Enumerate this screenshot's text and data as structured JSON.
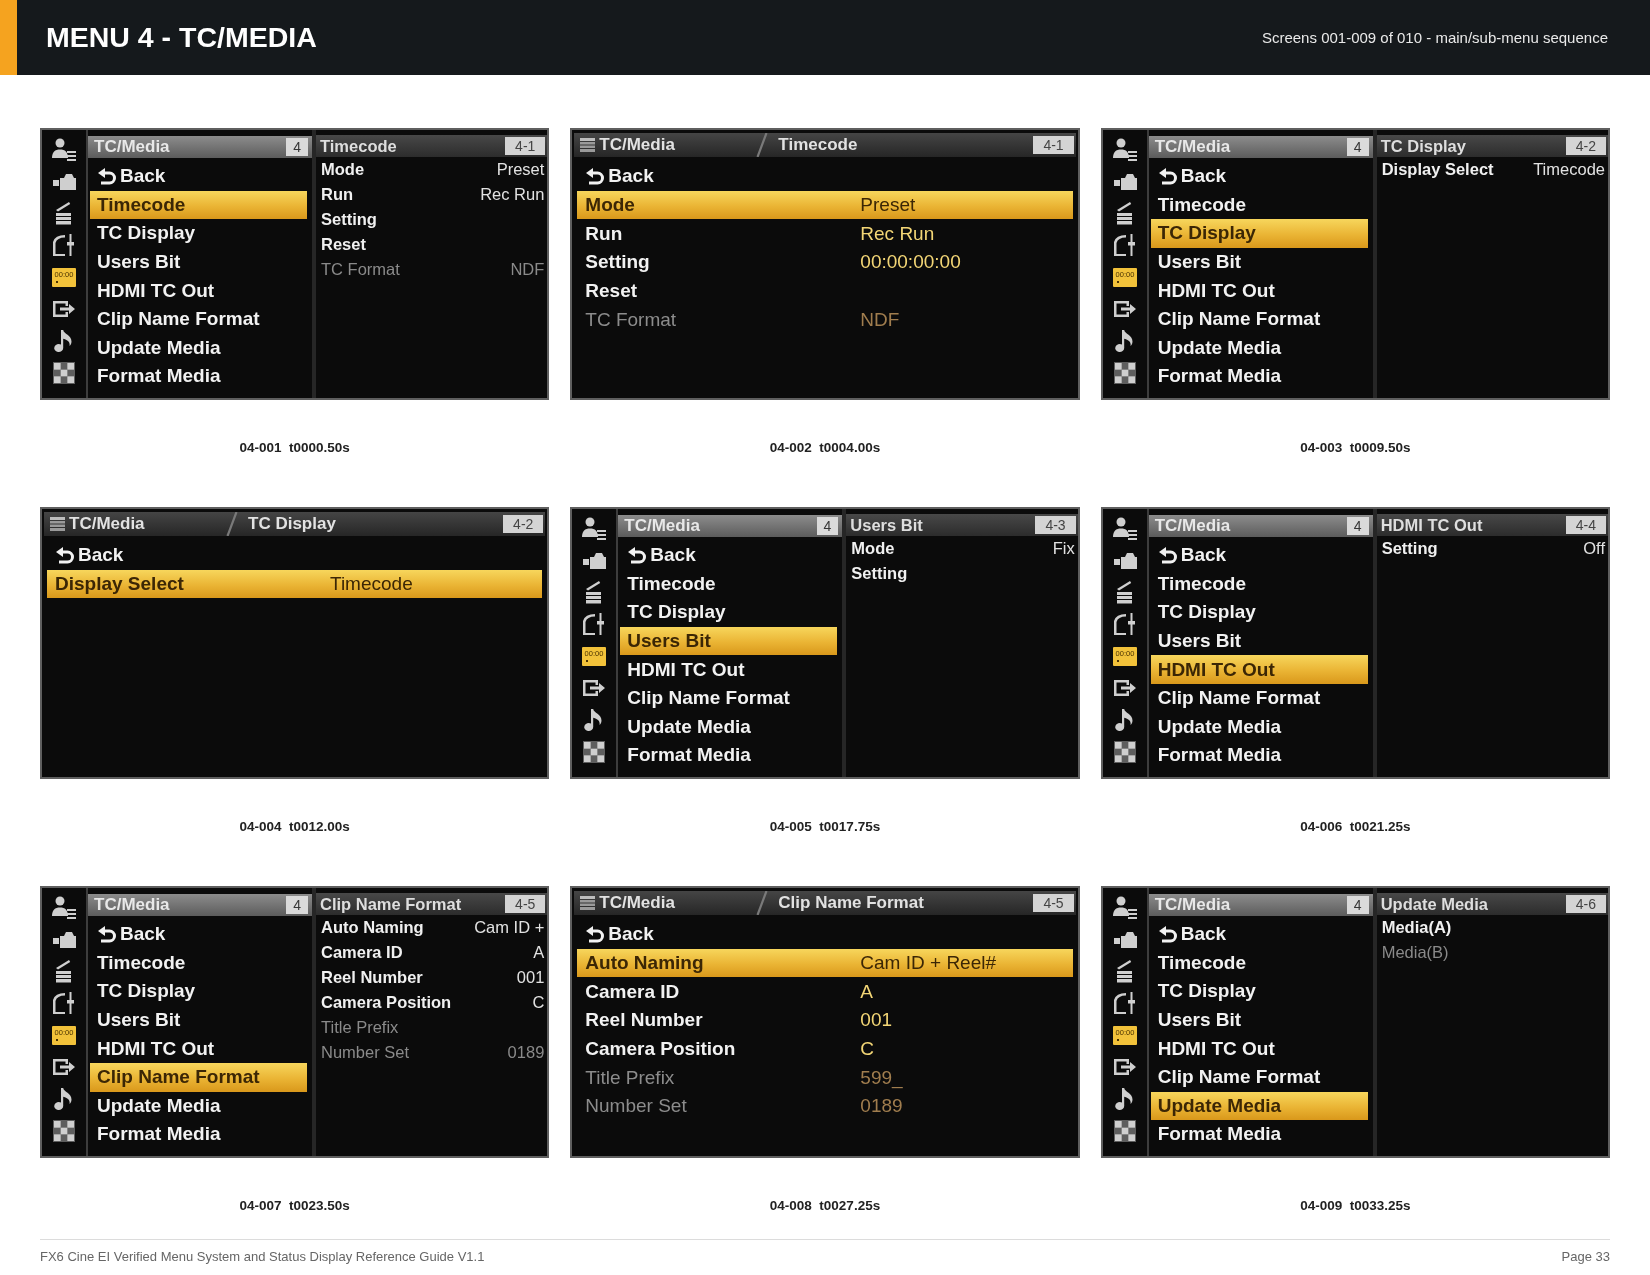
{
  "header": {
    "title": "MENU 4 - TC/MEDIA",
    "subtitle": "Screens 001-009 of 010 - main/sub-menu sequence"
  },
  "screens": [
    {
      "kind": "split",
      "caption": "04-001  t0000.50s",
      "sidebar": [
        {
          "kind": "user",
          "selected": false
        },
        {
          "kind": "camera",
          "selected": false
        },
        {
          "kind": "clapper",
          "selected": false
        },
        {
          "kind": "curve",
          "selected": false
        },
        {
          "kind": "timecode",
          "label": "00:00",
          "selected": true
        },
        {
          "kind": "output",
          "selected": false
        },
        {
          "kind": "audio",
          "selected": false
        },
        {
          "kind": "checker",
          "selected": false
        }
      ],
      "menu": {
        "title": "TC/Media",
        "badge": "4",
        "items": [
          {
            "kind": "back",
            "label": "Back",
            "selected": false
          },
          {
            "kind": "item",
            "label": "Timecode",
            "selected": true
          },
          {
            "kind": "item",
            "label": "TC Display",
            "selected": false
          },
          {
            "kind": "item",
            "label": "Users Bit",
            "selected": false
          },
          {
            "kind": "item",
            "label": "HDMI TC Out",
            "selected": false
          },
          {
            "kind": "item",
            "label": "Clip Name Format",
            "selected": false
          },
          {
            "kind": "item",
            "label": "Update Media",
            "selected": false
          },
          {
            "kind": "item",
            "label": "Format Media",
            "selected": false
          }
        ]
      },
      "submenu": {
        "title": "Timecode",
        "badge": "4-1",
        "rows": [
          {
            "label": "Mode",
            "value": "Preset",
            "disabled": false
          },
          {
            "label": "Run",
            "value": "Rec Run",
            "disabled": false
          },
          {
            "label": "Setting",
            "disabled": false
          },
          {
            "label": "Reset",
            "disabled": false
          },
          {
            "label": "TC Format",
            "value": "NDF",
            "disabled": true
          }
        ]
      }
    },
    {
      "kind": "full",
      "caption": "04-002  t0004.00s",
      "breadcrumb": {
        "parent": "TC/Media",
        "title": "Timecode",
        "badge": "4-1"
      },
      "rows": [
        {
          "kind": "back",
          "label": "Back",
          "selected": false,
          "disabled": false
        },
        {
          "kind": "setting",
          "label": "Mode",
          "value": "Preset",
          "selected": true,
          "disabled": false
        },
        {
          "kind": "setting",
          "label": "Run",
          "value": "Rec Run",
          "selected": false,
          "disabled": false
        },
        {
          "kind": "setting",
          "label": "Setting",
          "value": "00:00:00:00",
          "selected": false,
          "disabled": false
        },
        {
          "kind": "setting",
          "label": "Reset",
          "selected": false,
          "disabled": false
        },
        {
          "kind": "setting",
          "label": "TC Format",
          "value": "NDF",
          "selected": false,
          "disabled": true
        }
      ]
    },
    {
      "kind": "split",
      "caption": "04-003  t0009.50s",
      "sidebar": [
        {
          "kind": "user",
          "selected": false
        },
        {
          "kind": "camera",
          "selected": false
        },
        {
          "kind": "clapper",
          "selected": false
        },
        {
          "kind": "curve",
          "selected": false
        },
        {
          "kind": "timecode",
          "label": "00:00",
          "selected": true
        },
        {
          "kind": "output",
          "selected": false
        },
        {
          "kind": "audio",
          "selected": false
        },
        {
          "kind": "checker",
          "selected": false
        }
      ],
      "menu": {
        "title": "TC/Media",
        "badge": "4",
        "items": [
          {
            "kind": "back",
            "label": "Back",
            "selected": false
          },
          {
            "kind": "item",
            "label": "Timecode",
            "selected": false
          },
          {
            "kind": "item",
            "label": "TC Display",
            "selected": true
          },
          {
            "kind": "item",
            "label": "Users Bit",
            "selected": false
          },
          {
            "kind": "item",
            "label": "HDMI TC Out",
            "selected": false
          },
          {
            "kind": "item",
            "label": "Clip Name Format",
            "selected": false
          },
          {
            "kind": "item",
            "label": "Update Media",
            "selected": false
          },
          {
            "kind": "item",
            "label": "Format Media",
            "selected": false
          }
        ]
      },
      "submenu": {
        "title": "TC Display",
        "badge": "4-2",
        "rows": [
          {
            "label": "Display Select",
            "value": "Timecode",
            "disabled": false
          }
        ]
      }
    },
    {
      "kind": "full",
      "caption": "04-004  t0012.00s",
      "breadcrumb": {
        "parent": "TC/Media",
        "title": "TC Display",
        "badge": "4-2"
      },
      "rows": [
        {
          "kind": "back",
          "label": "Back",
          "selected": false,
          "disabled": false
        },
        {
          "kind": "setting",
          "label": "Display Select",
          "value": "Timecode",
          "selected": true,
          "disabled": false
        }
      ]
    },
    {
      "kind": "split",
      "caption": "04-005  t0017.75s",
      "sidebar": [
        {
          "kind": "user",
          "selected": false
        },
        {
          "kind": "camera",
          "selected": false
        },
        {
          "kind": "clapper",
          "selected": false
        },
        {
          "kind": "curve",
          "selected": false
        },
        {
          "kind": "timecode",
          "label": "00:00",
          "selected": true
        },
        {
          "kind": "output",
          "selected": false
        },
        {
          "kind": "audio",
          "selected": false
        },
        {
          "kind": "checker",
          "selected": false
        }
      ],
      "menu": {
        "title": "TC/Media",
        "badge": "4",
        "items": [
          {
            "kind": "back",
            "label": "Back",
            "selected": false
          },
          {
            "kind": "item",
            "label": "Timecode",
            "selected": false
          },
          {
            "kind": "item",
            "label": "TC Display",
            "selected": false
          },
          {
            "kind": "item",
            "label": "Users Bit",
            "selected": true
          },
          {
            "kind": "item",
            "label": "HDMI TC Out",
            "selected": false
          },
          {
            "kind": "item",
            "label": "Clip Name Format",
            "selected": false
          },
          {
            "kind": "item",
            "label": "Update Media",
            "selected": false
          },
          {
            "kind": "item",
            "label": "Format Media",
            "selected": false
          }
        ]
      },
      "submenu": {
        "title": "Users Bit",
        "badge": "4-3",
        "rows": [
          {
            "label": "Mode",
            "value": "Fix",
            "disabled": false
          },
          {
            "label": "Setting",
            "disabled": false
          }
        ]
      }
    },
    {
      "kind": "split",
      "caption": "04-006  t0021.25s",
      "sidebar": [
        {
          "kind": "user",
          "selected": false
        },
        {
          "kind": "camera",
          "selected": false
        },
        {
          "kind": "clapper",
          "selected": false
        },
        {
          "kind": "curve",
          "selected": false
        },
        {
          "kind": "timecode",
          "label": "00:00",
          "selected": true
        },
        {
          "kind": "output",
          "selected": false
        },
        {
          "kind": "audio",
          "selected": false
        },
        {
          "kind": "checker",
          "selected": false
        }
      ],
      "menu": {
        "title": "TC/Media",
        "badge": "4",
        "items": [
          {
            "kind": "back",
            "label": "Back",
            "selected": false
          },
          {
            "kind": "item",
            "label": "Timecode",
            "selected": false
          },
          {
            "kind": "item",
            "label": "TC Display",
            "selected": false
          },
          {
            "kind": "item",
            "label": "Users Bit",
            "selected": false
          },
          {
            "kind": "item",
            "label": "HDMI TC Out",
            "selected": true
          },
          {
            "kind": "item",
            "label": "Clip Name Format",
            "selected": false
          },
          {
            "kind": "item",
            "label": "Update Media",
            "selected": false
          },
          {
            "kind": "item",
            "label": "Format Media",
            "selected": false
          }
        ]
      },
      "submenu": {
        "title": "HDMI TC Out",
        "badge": "4-4",
        "rows": [
          {
            "label": "Setting",
            "value": "Off",
            "disabled": false
          }
        ]
      }
    },
    {
      "kind": "split",
      "caption": "04-007  t0023.50s",
      "sidebar": [
        {
          "kind": "user",
          "selected": false
        },
        {
          "kind": "camera",
          "selected": false
        },
        {
          "kind": "clapper",
          "selected": false
        },
        {
          "kind": "curve",
          "selected": false
        },
        {
          "kind": "timecode",
          "label": "00:00",
          "selected": true
        },
        {
          "kind": "output",
          "selected": false
        },
        {
          "kind": "audio",
          "selected": false
        },
        {
          "kind": "checker",
          "selected": false
        }
      ],
      "menu": {
        "title": "TC/Media",
        "badge": "4",
        "items": [
          {
            "kind": "back",
            "label": "Back",
            "selected": false
          },
          {
            "kind": "item",
            "label": "Timecode",
            "selected": false
          },
          {
            "kind": "item",
            "label": "TC Display",
            "selected": false
          },
          {
            "kind": "item",
            "label": "Users Bit",
            "selected": false
          },
          {
            "kind": "item",
            "label": "HDMI TC Out",
            "selected": false
          },
          {
            "kind": "item",
            "label": "Clip Name Format",
            "selected": true
          },
          {
            "kind": "item",
            "label": "Update Media",
            "selected": false
          },
          {
            "kind": "item",
            "label": "Format Media",
            "selected": false
          }
        ]
      },
      "submenu": {
        "title": "Clip Name Format",
        "badge": "4-5",
        "rows": [
          {
            "label": "Auto Naming",
            "value": "Cam ID +",
            "disabled": false
          },
          {
            "label": "Camera ID",
            "value": "A",
            "disabled": false
          },
          {
            "label": "Reel Number",
            "value": "001",
            "disabled": false
          },
          {
            "label": "Camera Position",
            "value": "C",
            "disabled": false
          },
          {
            "label": "Title Prefix",
            "disabled": true
          },
          {
            "label": "Number Set",
            "value": "0189",
            "disabled": true
          }
        ]
      }
    },
    {
      "kind": "full",
      "caption": "04-008  t0027.25s",
      "breadcrumb": {
        "parent": "TC/Media",
        "title": "Clip Name Format",
        "badge": "4-5"
      },
      "rows": [
        {
          "kind": "back",
          "label": "Back",
          "selected": false,
          "disabled": false
        },
        {
          "kind": "setting",
          "label": "Auto Naming",
          "value": "Cam ID + Reel#",
          "selected": true,
          "disabled": false
        },
        {
          "kind": "setting",
          "label": "Camera ID",
          "value": "A",
          "selected": false,
          "disabled": false
        },
        {
          "kind": "setting",
          "label": "Reel Number",
          "value": "001",
          "selected": false,
          "disabled": false
        },
        {
          "kind": "setting",
          "label": "Camera Position",
          "value": "C",
          "selected": false,
          "disabled": false
        },
        {
          "kind": "setting",
          "label": "Title Prefix",
          "value": "599_",
          "selected": false,
          "disabled": true
        },
        {
          "kind": "setting",
          "label": "Number Set",
          "value": "0189",
          "selected": false,
          "disabled": true
        }
      ]
    },
    {
      "kind": "split",
      "caption": "04-009  t0033.25s",
      "sidebar": [
        {
          "kind": "user",
          "selected": false
        },
        {
          "kind": "camera",
          "selected": false
        },
        {
          "kind": "clapper",
          "selected": false
        },
        {
          "kind": "curve",
          "selected": false
        },
        {
          "kind": "timecode",
          "label": "00:00",
          "selected": true
        },
        {
          "kind": "output",
          "selected": false
        },
        {
          "kind": "audio",
          "selected": false
        },
        {
          "kind": "checker",
          "selected": false
        }
      ],
      "menu": {
        "title": "TC/Media",
        "badge": "4",
        "items": [
          {
            "kind": "back",
            "label": "Back",
            "selected": false
          },
          {
            "kind": "item",
            "label": "Timecode",
            "selected": false
          },
          {
            "kind": "item",
            "label": "TC Display",
            "selected": false
          },
          {
            "kind": "item",
            "label": "Users Bit",
            "selected": false
          },
          {
            "kind": "item",
            "label": "HDMI TC Out",
            "selected": false
          },
          {
            "kind": "item",
            "label": "Clip Name Format",
            "selected": false
          },
          {
            "kind": "item",
            "label": "Update Media",
            "selected": true
          },
          {
            "kind": "item",
            "label": "Format Media",
            "selected": false
          }
        ]
      },
      "submenu": {
        "title": "Update Media",
        "badge": "4-6",
        "rows": [
          {
            "label": "Media(A)",
            "disabled": false
          },
          {
            "label": "Media(B)",
            "disabled": true
          }
        ]
      }
    }
  ],
  "footer": {
    "text": "FX6 Cine EI Verified Menu System and Status Display Reference Guide V1.1",
    "page": "Page 33"
  }
}
